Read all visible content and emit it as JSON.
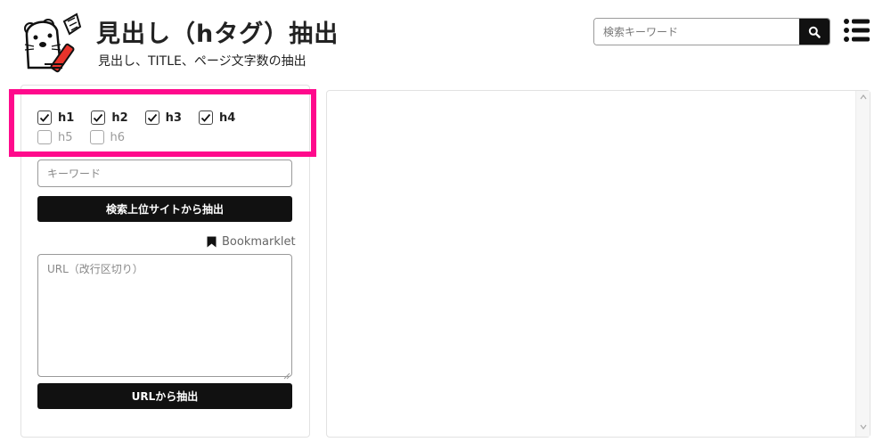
{
  "header": {
    "title": "見出し（hタグ）抽出",
    "subtitle": "見出し、TITLE、ページ文字数の抽出",
    "logo_icon": "otter-mascot-icon",
    "search": {
      "placeholder": "検索キーワード",
      "icon": "search-icon"
    },
    "menu_icon": "hamburger-menu-icon"
  },
  "options": {
    "checkboxes": [
      {
        "label": "h1",
        "checked": true
      },
      {
        "label": "h2",
        "checked": true
      },
      {
        "label": "h3",
        "checked": true
      },
      {
        "label": "h4",
        "checked": true
      },
      {
        "label": "h5",
        "checked": false
      },
      {
        "label": "h6",
        "checked": false
      }
    ]
  },
  "keyword": {
    "placeholder": "キーワード"
  },
  "buttons": {
    "search_extract": "検索上位サイトから抽出",
    "url_extract": "URLから抽出"
  },
  "bookmarklet": {
    "label": "Bookmarklet",
    "icon": "bookmark-icon"
  },
  "url_input": {
    "placeholder": "URL（改行区切り）"
  },
  "colors": {
    "highlight": "#ff0a8c",
    "button_bg": "#111111",
    "button_text": "#ffffff",
    "accent_red": "#e8332b"
  }
}
